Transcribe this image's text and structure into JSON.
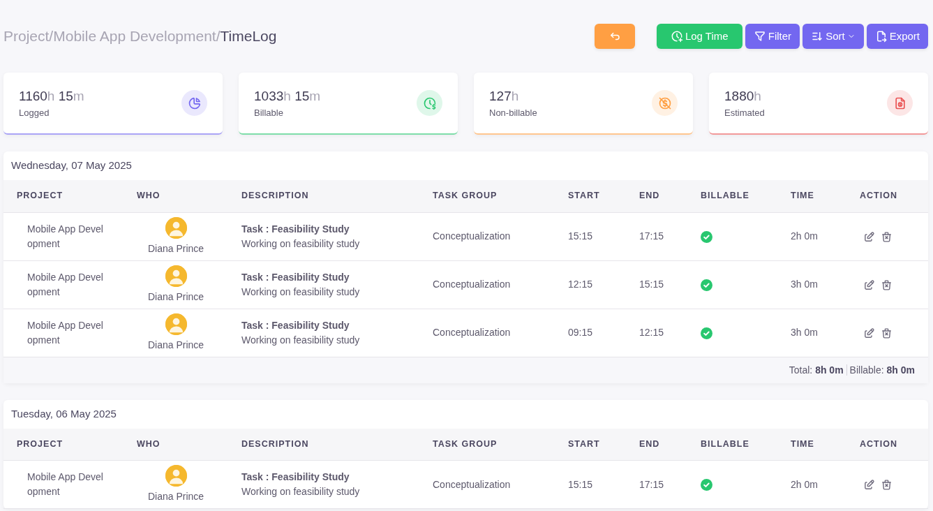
{
  "breadcrumb": [
    {
      "label": "Project",
      "current": false
    },
    {
      "label": "Mobile App Development",
      "current": false
    },
    {
      "label": "TimeLog",
      "current": true
    }
  ],
  "breadcrumb_separator": "/",
  "actions": [
    {
      "kind": "back"
    },
    {
      "kind": "log",
      "label": "Log Time"
    },
    {
      "kind": "filter",
      "label": "Filter"
    },
    {
      "kind": "sort",
      "label": "Sort"
    },
    {
      "kind": "export",
      "label": "Export"
    }
  ],
  "stats": [
    {
      "kind": "logged",
      "color": "#7367f0",
      "parts": [
        {
          "num": "1160",
          "unit": "h"
        },
        {
          "num": "15",
          "unit": "m"
        }
      ],
      "label": "Logged"
    },
    {
      "kind": "billable",
      "color": "#28c76f",
      "parts": [
        {
          "num": "1033",
          "unit": "h"
        },
        {
          "num": "15",
          "unit": "m"
        }
      ],
      "label": "Billable"
    },
    {
      "kind": "nonbillable",
      "color": "#ff9f43",
      "parts": [
        {
          "num": "127",
          "unit": "h"
        }
      ],
      "label": "Non-billable"
    },
    {
      "kind": "estimated",
      "color": "#ea5455",
      "parts": [
        {
          "num": "1880",
          "unit": "h"
        }
      ],
      "label": "Estimated"
    }
  ],
  "days": [
    {
      "date": "Wednesday, 07 May 2025",
      "columns": [
        "PROJECT",
        "WHO",
        "DESCRIPTION",
        "TASK GROUP",
        "START",
        "END",
        "BILLABLE",
        "TIME",
        "ACTION"
      ],
      "rows": [
        {
          "project": "Mobile App Development",
          "who": "Diana Prince",
          "task": "Task : Feasibility Study",
          "note": "Working on feasibility study",
          "group": "Conceptualization",
          "start": "15:15",
          "end": "17:15",
          "billable": true,
          "time": "2h 0m"
        },
        {
          "project": "Mobile App Development",
          "who": "Diana Prince",
          "task": "Task : Feasibility Study",
          "note": "Working on feasibility study",
          "group": "Conceptualization",
          "start": "12:15",
          "end": "15:15",
          "billable": true,
          "time": "3h 0m"
        },
        {
          "project": "Mobile App Development",
          "who": "Diana Prince",
          "task": "Task : Feasibility Study",
          "note": "Working on feasibility study",
          "group": "Conceptualization",
          "start": "09:15",
          "end": "12:15",
          "billable": true,
          "time": "3h 0m"
        }
      ],
      "totals": [
        {
          "label": "Total:",
          "value": "8h 0m"
        },
        {
          "label": "Billable:",
          "value": "8h 0m"
        }
      ]
    },
    {
      "date": "Tuesday, 06 May 2025",
      "columns": [
        "PROJECT",
        "WHO",
        "DESCRIPTION",
        "TASK GROUP",
        "START",
        "END",
        "BILLABLE",
        "TIME",
        "ACTION"
      ],
      "rows": [
        {
          "project": "Mobile App Development",
          "who": "Diana Prince",
          "task": "Task : Feasibility Study",
          "note": "Working on feasibility study",
          "group": "Conceptualization",
          "start": "15:15",
          "end": "17:15",
          "billable": true,
          "time": "2h 0m"
        }
      ]
    }
  ]
}
